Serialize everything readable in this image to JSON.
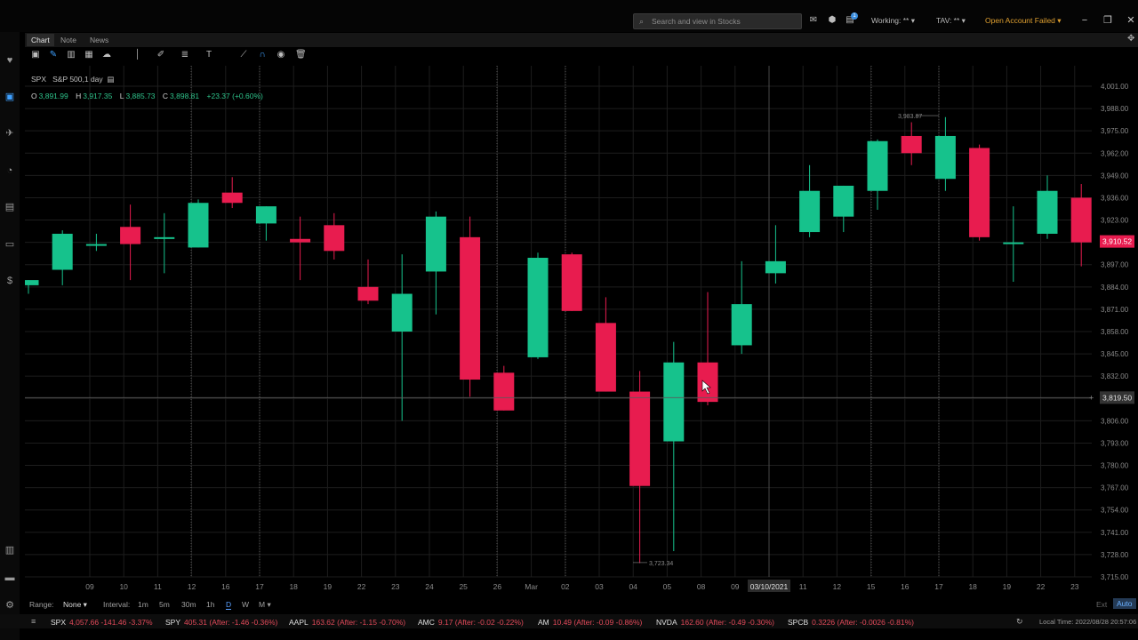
{
  "app": {
    "search_placeholder": "Search and view in Stocks",
    "working_label": "Working: ** ▾",
    "tav_label": "TAV: ** ▾",
    "open_account_label": "Open Account Failed ▾",
    "notification_count": "1"
  },
  "tabs": [
    {
      "label": "Chart",
      "active": true
    },
    {
      "label": "Note",
      "active": false
    },
    {
      "label": "News",
      "active": false
    }
  ],
  "symbol": {
    "ticker": "SPX",
    "name": "S&P 500,1 day",
    "ohlc": {
      "o_label": "O",
      "open": "3,891.99",
      "h_label": "H",
      "high": "3,917.35",
      "l_label": "L",
      "low": "3,885.73",
      "c_label": "C",
      "close": "3,898.81",
      "change": "+23.37 (+0.60%)"
    }
  },
  "chart_data": {
    "type": "candlestick",
    "y_ticks": [
      "4,001.00",
      "3,988.00",
      "3,975.00",
      "3,962.00",
      "3,949.00",
      "3,936.00",
      "3,923.00",
      "3,910.00",
      "3,897.00",
      "3,884.00",
      "3,871.00",
      "3,858.00",
      "3,845.00",
      "3,832.00",
      "3,819.00",
      "3,806.00",
      "3,793.00",
      "3,780.00",
      "3,767.00",
      "3,754.00",
      "3,741.00",
      "3,728.00",
      "3,715.00"
    ],
    "ylim": [
      3708,
      4008
    ],
    "x_labels": [
      "09",
      "10",
      "11",
      "12",
      "16",
      "17",
      "18",
      "19",
      "22",
      "23",
      "24",
      "25",
      "26",
      "Mar",
      "02",
      "03",
      "04",
      "05",
      "08",
      "09",
      "03/10/2021",
      "11",
      "12",
      "15",
      "16",
      "17",
      "18",
      "19",
      "22",
      "23"
    ],
    "current_price_label": "3,910.52",
    "crosshair_price_label": "3,819.50",
    "crosshair_price": 3819.5,
    "high_annotation": "3,983.87",
    "low_annotation": "3,723.34",
    "colors": {
      "up": "#16c28c",
      "down": "#e81c4f",
      "grid": "#1d1d1d"
    },
    "candles": [
      {
        "o": 3885,
        "h": 3888,
        "l": 3880,
        "c": 3888
      },
      {
        "o": 3894,
        "h": 3917,
        "l": 3885,
        "c": 3915
      },
      {
        "o": 3908,
        "h": 3915,
        "l": 3905,
        "c": 3909
      },
      {
        "o": 3919,
        "h": 3932,
        "l": 3888,
        "c": 3909
      },
      {
        "o": 3913,
        "h": 3927,
        "l": 3892,
        "c": 3913
      },
      {
        "o": 3907,
        "h": 3935,
        "l": 3907,
        "c": 3933
      },
      {
        "o": 3939,
        "h": 3948,
        "l": 3930,
        "c": 3933
      },
      {
        "o": 3921,
        "h": 3931,
        "l": 3911,
        "c": 3931
      },
      {
        "o": 3912,
        "h": 3925,
        "l": 3888,
        "c": 3910
      },
      {
        "o": 3920,
        "h": 3927,
        "l": 3900,
        "c": 3905
      },
      {
        "o": 3884,
        "h": 3900,
        "l": 3874,
        "c": 3876
      },
      {
        "o": 3858,
        "h": 3903,
        "l": 3806,
        "c": 3880
      },
      {
        "o": 3893,
        "h": 3928,
        "l": 3868,
        "c": 3925
      },
      {
        "o": 3913,
        "h": 3925,
        "l": 3820,
        "c": 3830
      },
      {
        "o": 3834,
        "h": 3838,
        "l": 3812,
        "c": 3812
      },
      {
        "o": 3843,
        "h": 3904,
        "l": 3842,
        "c": 3901
      },
      {
        "o": 3903,
        "h": 3904,
        "l": 3870,
        "c": 3870
      },
      {
        "o": 3863,
        "h": 3878,
        "l": 3823,
        "c": 3823
      },
      {
        "o": 3823,
        "h": 3835,
        "l": 3723,
        "c": 3768
      },
      {
        "o": 3794,
        "h": 3852,
        "l": 3730,
        "c": 3840
      },
      {
        "o": 3840,
        "h": 3881,
        "l": 3815,
        "c": 3817
      },
      {
        "o": 3850,
        "h": 3899,
        "l": 3845,
        "c": 3874
      },
      {
        "o": 3892,
        "h": 3920,
        "l": 3886,
        "c": 3899
      },
      {
        "o": 3916,
        "h": 3955,
        "l": 3913,
        "c": 3940
      },
      {
        "o": 3925,
        "h": 3943,
        "l": 3916,
        "c": 3943
      },
      {
        "o": 3940,
        "h": 3970,
        "l": 3929,
        "c": 3969
      },
      {
        "o": 3972,
        "h": 3980,
        "l": 3955,
        "c": 3962
      },
      {
        "o": 3947,
        "h": 3983,
        "l": 3940,
        "c": 3972
      },
      {
        "o": 3965,
        "h": 3967,
        "l": 3911,
        "c": 3913
      },
      {
        "o": 3910,
        "h": 3931,
        "l": 3887,
        "c": 3910
      },
      {
        "o": 3915,
        "h": 3949,
        "l": 3912,
        "c": 3940
      },
      {
        "o": 3936,
        "h": 3944,
        "l": 3896,
        "c": 3910
      }
    ]
  },
  "bottom": {
    "range_label": "Range:",
    "range_value": "None ▾",
    "interval_label": "Interval:",
    "intervals": [
      "1m",
      "5m",
      "30m",
      "1h",
      "D",
      "W",
      "M ▾"
    ],
    "ext_label": "Ext",
    "auto_label": "Auto"
  },
  "tickers": [
    {
      "sym": "SPX",
      "val": "4,057.66 -141.46 -3.37%"
    },
    {
      "sym": "SPY",
      "val": "405.31 (After: -1.46 -0.36%)"
    },
    {
      "sym": "AAPL",
      "val": "163.62 (After: -1.15 -0.70%)"
    },
    {
      "sym": "AMC",
      "val": "9.17 (After: -0.02 -0.22%)"
    },
    {
      "sym": "AM",
      "val": "10.49 (After: -0.09 -0.86%)"
    },
    {
      "sym": "NVDA",
      "val": "162.60 (After: -0.49 -0.30%)"
    },
    {
      "sym": "SPCB",
      "val": "0.3226 (After: -0.0026 -0.81%)"
    }
  ],
  "local_time": "Local Time: 2022/08/28 20:57:06"
}
